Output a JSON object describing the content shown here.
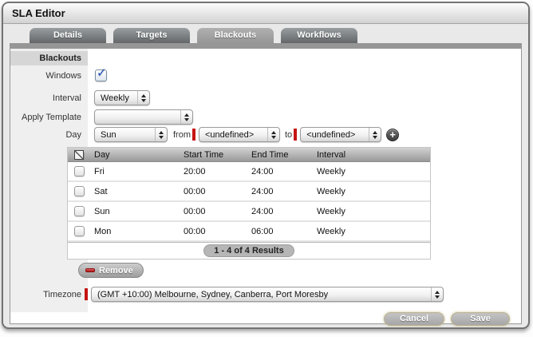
{
  "window": {
    "title": "SLA Editor"
  },
  "tabs": [
    {
      "label": "Details",
      "active": false
    },
    {
      "label": "Targets",
      "active": false
    },
    {
      "label": "Blackouts",
      "active": true
    },
    {
      "label": "Workflows",
      "active": false
    }
  ],
  "section": {
    "header": "Blackouts"
  },
  "form": {
    "windows": {
      "label": "Windows",
      "checked": true
    },
    "interval": {
      "label": "Interval",
      "value": "Weekly"
    },
    "apply_template": {
      "label": "Apply Template",
      "value": ""
    },
    "day": {
      "label": "Day",
      "day_value": "Sun",
      "from_label": "from",
      "from_value": "<undefined>",
      "to_label": "to",
      "to_value": "<undefined>"
    },
    "timezone": {
      "label": "Timezone",
      "value": "(GMT +10:00) Melbourne, Sydney, Canberra, Port Moresby",
      "required": true
    }
  },
  "table": {
    "columns": {
      "day": "Day",
      "start": "Start Time",
      "end": "End Time",
      "interval": "Interval"
    },
    "rows": [
      {
        "day": "Fri",
        "start": "20:00",
        "end": "24:00",
        "interval": "Weekly"
      },
      {
        "day": "Sat",
        "start": "00:00",
        "end": "24:00",
        "interval": "Weekly"
      },
      {
        "day": "Sun",
        "start": "00:00",
        "end": "24:00",
        "interval": "Weekly"
      },
      {
        "day": "Mon",
        "start": "00:00",
        "end": "06:00",
        "interval": "Weekly"
      }
    ],
    "pagination": "1 - 4 of 4 Results"
  },
  "buttons": {
    "remove": "Remove",
    "cancel": "Cancel",
    "save": "Save"
  },
  "icons": {
    "check": "✓",
    "add": "+"
  },
  "colors": {
    "required_marker": "#c51414",
    "active_tab": "#a3a3a3",
    "inactive_tab": "#6b6f72",
    "check_blue": "#1d4fc0",
    "remove_red": "#a61212"
  }
}
